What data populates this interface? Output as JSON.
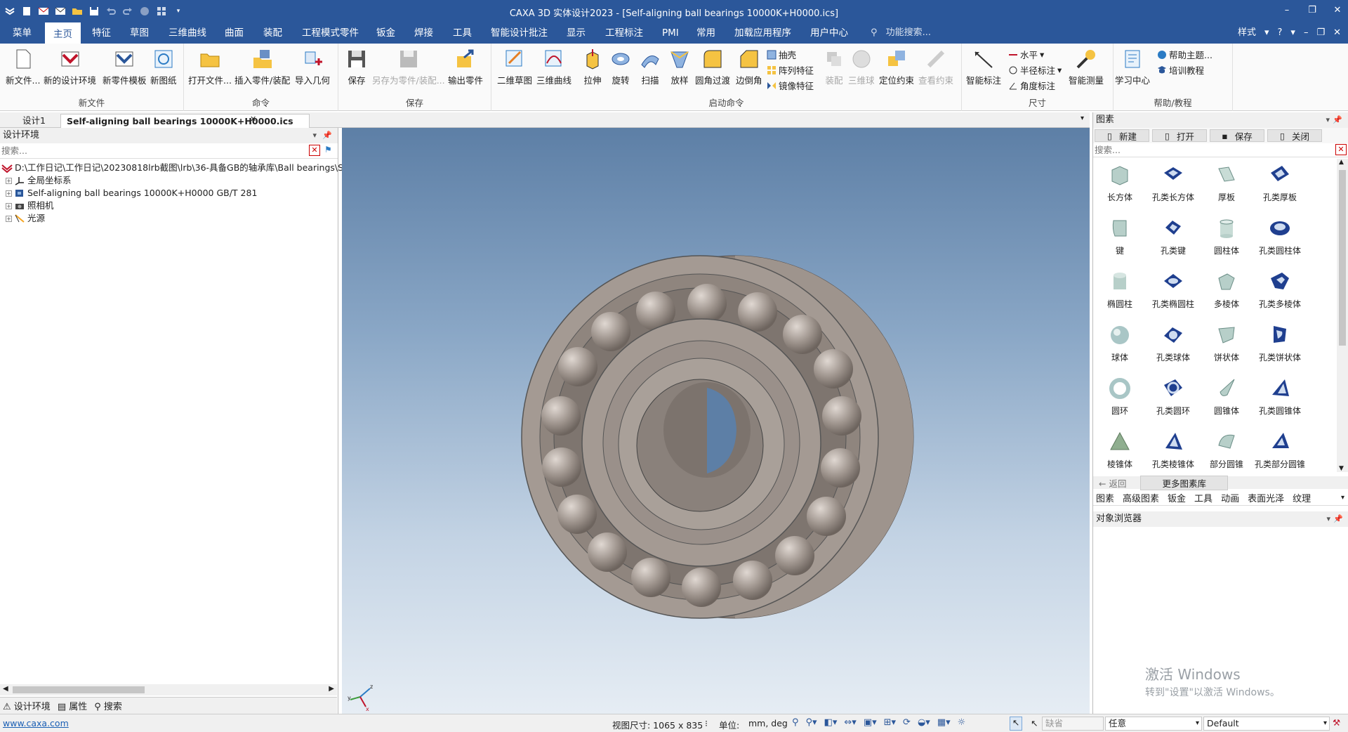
{
  "window": {
    "title": "CAXA 3D 实体设计2023 - [Self-aligning ball bearings 10000K+H0000.ics]",
    "controls": [
      "minimize",
      "restore",
      "close"
    ]
  },
  "quick_access": [
    "app-menu-icon",
    "new-icon",
    "mail-icon",
    "mail-alt-icon",
    "open-folder-icon",
    "save-icon",
    "undo-icon",
    "redo-icon",
    "circle-icon",
    "grid-icon"
  ],
  "ribbon_tabs": [
    "菜单",
    "主页",
    "特征",
    "草图",
    "三维曲线",
    "曲面",
    "装配",
    "工程模式零件",
    "钣金",
    "焊接",
    "工具",
    "智能设计批注",
    "显示",
    "工程标注",
    "PMI",
    "常用",
    "加载应用程序",
    "用户中心"
  ],
  "active_tab": "主页",
  "function_search_placeholder": "功能搜索...",
  "tab_right": {
    "style_label": "样式"
  },
  "ribbon": {
    "groups": [
      {
        "label": "新文件",
        "buttons": [
          "新文件...",
          "新的设计环境",
          "新零件模板",
          "新图纸"
        ]
      },
      {
        "label": "命令",
        "buttons": [
          "打开文件...",
          "插入零件/装配",
          "导入几何"
        ]
      },
      {
        "label": "保存",
        "buttons": [
          "保存",
          "另存为零件/装配...",
          "输出零件"
        ]
      },
      {
        "label": "启动命令",
        "buttons": [
          "二维草图",
          "三维曲线",
          "拉伸",
          "旋转",
          "扫描",
          "放样",
          "圆角过渡",
          "边倒角",
          "装配",
          "三维球",
          "定位约束",
          "查看约束"
        ],
        "small_buttons": [
          "抽壳",
          "阵列特征",
          "镜像特征"
        ]
      },
      {
        "label": "尺寸",
        "buttons": [
          "智能标注",
          "智能测量"
        ],
        "small_buttons": [
          "水平",
          "半径标注",
          "角度标注"
        ]
      },
      {
        "label": "帮助/教程",
        "buttons": [
          "学习中心"
        ],
        "small_buttons": [
          "帮助主题...",
          "培训教程"
        ]
      }
    ]
  },
  "doc_tabs": [
    "设计1",
    "Self-aligning ball bearings 10000K+H0000.ics"
  ],
  "left_panel": {
    "title": "设计环境",
    "search_placeholder": "搜索...",
    "tree": [
      {
        "label": "D:\\工作日记\\工作日记\\20230818lrb截图\\lrb\\36-具备GB的轴承库\\Ball bearings\\Se",
        "icon": "root-icon",
        "expander": false
      },
      {
        "label": "全局坐标系",
        "icon": "axes-icon",
        "expander": true
      },
      {
        "label": "Self-aligning ball bearings 10000K+H0000 GB/T 281",
        "icon": "part-icon",
        "expander": true
      },
      {
        "label": "照相机",
        "icon": "camera-icon",
        "expander": true
      },
      {
        "label": "光源",
        "icon": "light-icon",
        "expander": true
      }
    ],
    "bottom_tabs": [
      "设计环境",
      "属性",
      "搜索"
    ]
  },
  "right_panel": {
    "title": "图素",
    "toolbar": [
      "新建",
      "打开",
      "保存",
      "关闭"
    ],
    "search_placeholder": "搜索...",
    "shapes": [
      "长方体",
      "孔类长方体",
      "厚板",
      "孔类厚板",
      "键",
      "孔类键",
      "圆柱体",
      "孔类圆柱体",
      "椭圆柱",
      "孔类椭圆柱",
      "多棱体",
      "孔类多棱体",
      "球体",
      "孔类球体",
      "饼状体",
      "孔类饼状体",
      "圆环",
      "孔类圆环",
      "圆锥体",
      "孔类圆锥体",
      "棱锥体",
      "孔类棱锥体",
      "部分圆锥",
      "孔类部分圆锥"
    ],
    "library": {
      "back": "返回",
      "more": "更多图素库"
    },
    "category_tabs": [
      "图素",
      "高级图素",
      "钣金",
      "工具",
      "动画",
      "表面光泽",
      "纹理"
    ],
    "object_browser": "对象浏览器"
  },
  "watermark": {
    "line1": "激活 Windows",
    "line2": "转到\"设置\"以激活 Windows。"
  },
  "status": {
    "link": "www.caxa.com",
    "view_size": "视图尺寸: 1065 x  835",
    "unit_label": "单位:",
    "unit_value": "mm, deg",
    "filter_default": "缺省",
    "select_mode": "任意",
    "profile": "Default"
  },
  "colors": {
    "title_bar": "#2b579a",
    "accent": "#2b579a"
  }
}
